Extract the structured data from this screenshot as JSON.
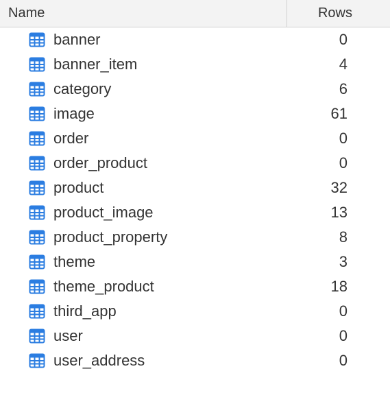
{
  "columns": {
    "name": "Name",
    "rows": "Rows"
  },
  "tables": [
    {
      "name": "banner",
      "rows": 0
    },
    {
      "name": "banner_item",
      "rows": 4
    },
    {
      "name": "category",
      "rows": 6
    },
    {
      "name": "image",
      "rows": 61
    },
    {
      "name": "order",
      "rows": 0
    },
    {
      "name": "order_product",
      "rows": 0
    },
    {
      "name": "product",
      "rows": 32
    },
    {
      "name": "product_image",
      "rows": 13
    },
    {
      "name": "product_property",
      "rows": 8
    },
    {
      "name": "theme",
      "rows": 3
    },
    {
      "name": "theme_product",
      "rows": 18
    },
    {
      "name": "third_app",
      "rows": 0
    },
    {
      "name": "user",
      "rows": 0
    },
    {
      "name": "user_address",
      "rows": 0
    }
  ]
}
